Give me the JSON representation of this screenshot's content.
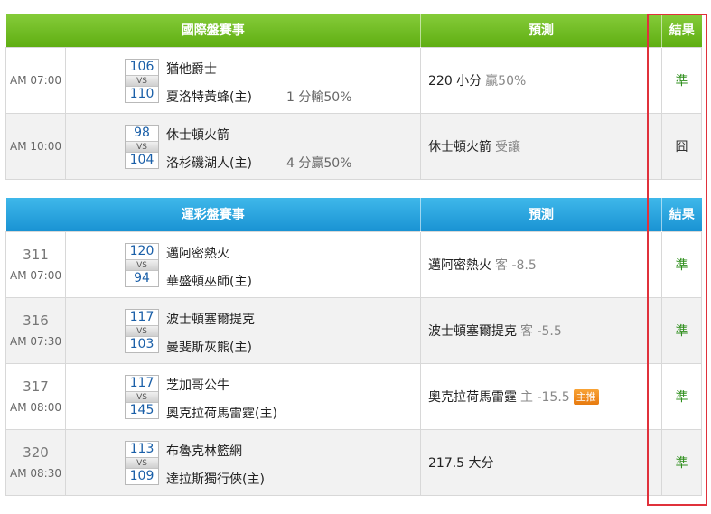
{
  "international": {
    "header": {
      "title": "國際盤賽事",
      "prediction": "預測",
      "result": "結果"
    },
    "rows": [
      {
        "time": "AM 07:00",
        "away_score": "106",
        "vs": "VS",
        "home_score": "110",
        "away_team": "猶他爵士",
        "home_team": "夏洛特黃蜂(主)",
        "handicap": "1 分輸50%",
        "prediction_main": "220 小分",
        "prediction_sub": "贏50%",
        "result": "準"
      },
      {
        "time": "AM 10:00",
        "away_score": "98",
        "vs": "VS",
        "home_score": "104",
        "away_team": "休士頓火箭",
        "home_team": "洛杉磯湖人(主)",
        "handicap": "4 分贏50%",
        "prediction_main": "休士頓火箭",
        "prediction_sub": "受讓",
        "result": "囧"
      }
    ]
  },
  "lottery": {
    "header": {
      "title": "運彩盤賽事",
      "prediction": "預測",
      "result": "結果"
    },
    "rows": [
      {
        "number": "311",
        "time": "AM 07:00",
        "away_score": "120",
        "vs": "VS",
        "home_score": "94",
        "away_team": "邁阿密熱火",
        "home_team": "華盛頓巫師(主)",
        "prediction_main": "邁阿密熱火",
        "prediction_sub": "客 -8.5",
        "result": "準"
      },
      {
        "number": "316",
        "time": "AM 07:30",
        "away_score": "117",
        "vs": "VS",
        "home_score": "103",
        "away_team": "波士頓塞爾提克",
        "home_team": "曼斐斯灰熊(主)",
        "prediction_main": "波士頓塞爾提克",
        "prediction_sub": "客 -5.5",
        "result": "準"
      },
      {
        "number": "317",
        "time": "AM 08:00",
        "away_score": "117",
        "vs": "VS",
        "home_score": "145",
        "away_team": "芝加哥公牛",
        "home_team": "奧克拉荷馬雷霆(主)",
        "prediction_main": "奧克拉荷馬雷霆",
        "prediction_sub": "主 -15.5",
        "badge": "主推",
        "result": "準"
      },
      {
        "number": "320",
        "time": "AM 08:30",
        "away_score": "113",
        "vs": "VS",
        "home_score": "109",
        "away_team": "布魯克林籃網",
        "home_team": "達拉斯獨行俠(主)",
        "prediction_main": "217.5 大分",
        "prediction_sub": "",
        "result": "準"
      }
    ]
  },
  "colors": {
    "international_header": "#6cba1f",
    "lottery_header": "#2aa5e0",
    "result_correct": "#2f8f1d",
    "highlight_border": "#e0313b",
    "badge": "#f08c20"
  }
}
